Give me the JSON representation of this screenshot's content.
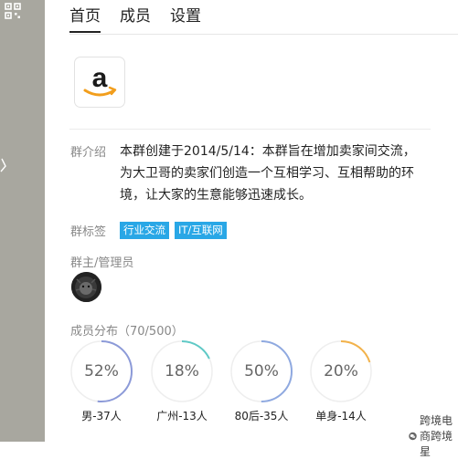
{
  "tabs": [
    {
      "label": "首页",
      "active": true
    },
    {
      "label": "成员",
      "active": false
    },
    {
      "label": "设置",
      "active": false
    }
  ],
  "group": {
    "logo_letter": "a",
    "intro_label": "群介绍",
    "intro_text": "本群创建于2014/5/14：本群旨在增加卖家间交流，为大卫哥的卖家们创造一个互相学习、互相帮助的环境，让大家的生意能够迅速成长。",
    "tags_label": "群标签",
    "tags": [
      "行业交流",
      "IT/互联网"
    ],
    "owner_label": "群主/管理员",
    "distribution_label": "成员分布（70/500）"
  },
  "stats": [
    {
      "percent": "52%",
      "value": 0.52,
      "caption": "男-37人",
      "color": "#8c9ad8"
    },
    {
      "percent": "18%",
      "value": 0.18,
      "caption": "广州-13人",
      "color": "#5fc9c6"
    },
    {
      "percent": "50%",
      "value": 0.5,
      "caption": "80后-35人",
      "color": "#8fa9e0"
    },
    {
      "percent": "20%",
      "value": 0.2,
      "caption": "单身-14人",
      "color": "#f2b24b"
    }
  ],
  "watermark": {
    "text": "跨境电商跨境星"
  },
  "colors": {
    "sidebar": "#a8a79f",
    "tag": "#29a7e6"
  }
}
